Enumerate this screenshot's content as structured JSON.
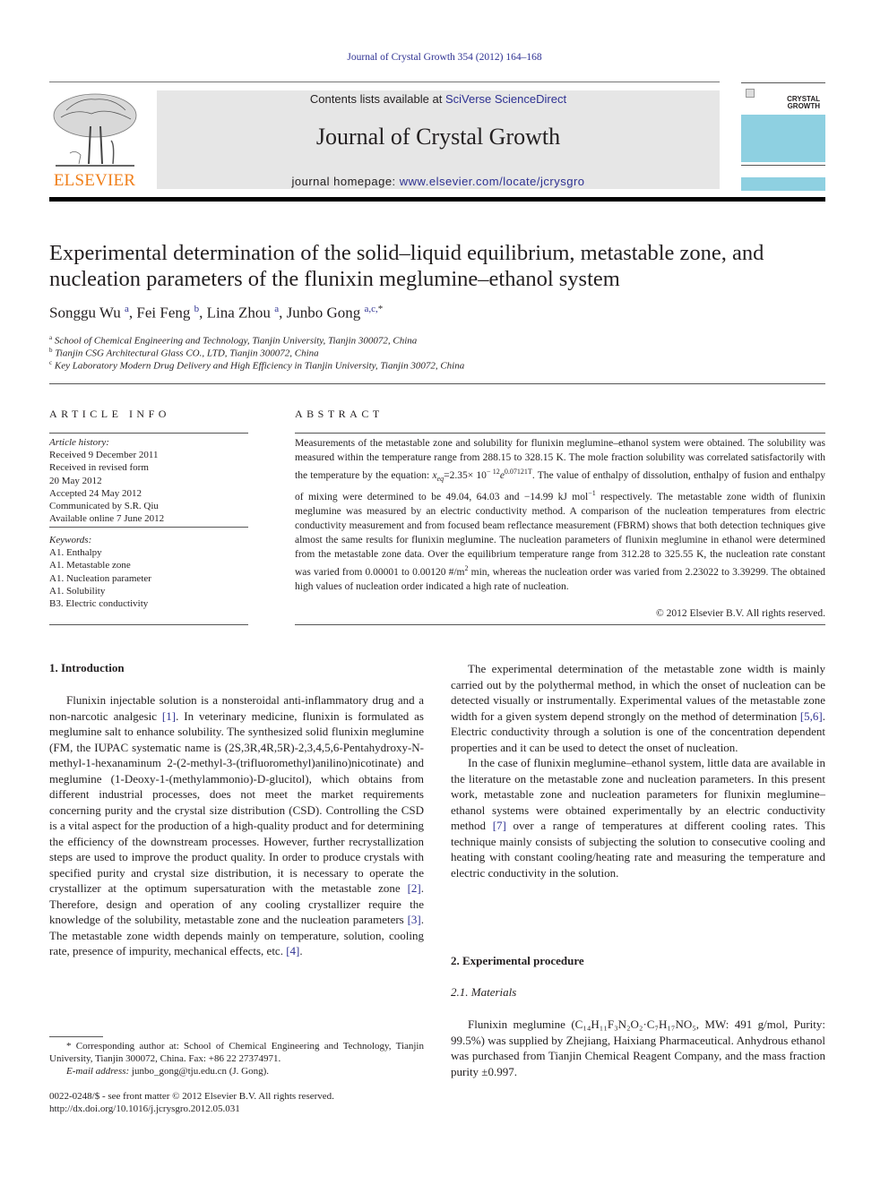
{
  "header": {
    "journal_ref": "Journal of Crystal Growth 354 (2012) 164–168",
    "contents_prefix": "Contents lists available at ",
    "contents_link": "SciVerse ScienceDirect",
    "journal_title": "Journal of Crystal Growth",
    "homepage_prefix": "journal homepage: ",
    "homepage_link": "www.elsevier.com/locate/jcrysgro",
    "publisher_logo_text": "ELSEVIER",
    "cover_title_line1": "CRYSTAL",
    "cover_title_line2": "GROWTH",
    "colors": {
      "link": "#2e3192",
      "elsevier_orange": "#f07f1a",
      "band_gray": "#e6e6e6",
      "cover_blue": "#8ed0e1"
    }
  },
  "article": {
    "title": "Experimental determination of the solid–liquid equilibrium, metastable zone, and nucleation parameters of the flunixin meglumine–ethanol system",
    "authors": [
      {
        "name": "Songgu Wu",
        "sup": "a"
      },
      {
        "name": "Fei Feng",
        "sup": "b"
      },
      {
        "name": "Lina Zhou",
        "sup": "a"
      },
      {
        "name": "Junbo Gong",
        "sup": "a,c,",
        "star": "*"
      }
    ],
    "affiliations": [
      {
        "mark": "a",
        "text": "School of Chemical Engineering and Technology, Tianjin University, Tianjin 300072, China"
      },
      {
        "mark": "b",
        "text": "Tianjin CSG Architectural Glass CO., LTD, Tianjin 300072, China"
      },
      {
        "mark": "c",
        "text": "Key Laboratory Modern Drug Delivery and High Efficiency in Tianjin University, Tianjin 30072, China"
      }
    ]
  },
  "article_info": {
    "heading": "ARTICLE INFO",
    "history_label": "Article history:",
    "history": [
      "Received 9 December 2011",
      "Received in revised form",
      "20 May 2012",
      "Accepted 24 May 2012",
      "Communicated by S.R. Qiu",
      "Available online 7 June 2012"
    ],
    "keywords_label": "Keywords:",
    "keywords": [
      "A1. Enthalpy",
      "A1. Metastable zone",
      "A1. Nucleation parameter",
      "A1. Solubility",
      "B3. Electric conductivity"
    ]
  },
  "abstract": {
    "heading": "ABSTRACT",
    "part1": "Measurements of the metastable zone and solubility for flunixin meglumine–ethanol system were obtained. The solubility was measured within the temperature range from 288.15 to 328.15 K. The mole fraction solubility was correlated satisfactorily with the temperature by the equation: ",
    "eq_x": "x",
    "eq_sub": "eq",
    "eq_mid": "=2.35× 10",
    "eq_exp1": "− 12",
    "eq_e": "e",
    "eq_exp2": "0.07121T",
    "part2": ". The value of enthalpy of dissolution, enthalpy of fusion and enthalpy of mixing were determined to be 49.04, 64.03 and −14.99 kJ mol",
    "unit_exp": "−1",
    "part3": " respectively. The metastable zone width of flunixin meglumine was measured by an electric conductivity method. A comparison of the nucleation temperatures from electric conductivity measurement and from focused beam reflectance measurement (FBRM) shows that both detection techniques give almost the same results for flunixin meglumine. The nucleation parameters of flunixin meglumine in ethanol were determined from the metastable zone data. Over the equilibrium temperature range from 312.28 to 325.55 K, the nucleation rate constant was varied from 0.00001 to 0.00120 #/m",
    "area_exp": "2",
    "part4": " min, whereas the nucleation order was varied from 2.23022 to 3.39299. The obtained high values of nucleation order indicated a high rate of nucleation.",
    "copyright": "© 2012 Elsevier B.V. All rights reserved."
  },
  "body": {
    "intro_heading": "1.  Introduction",
    "intro_p1_a": "Flunixin injectable solution is a nonsteroidal anti-inflammatory drug and a non-narcotic analgesic ",
    "ref1": "[1]",
    "intro_p1_b": ". In veterinary medicine, flunixin is formulated as meglumine salt to enhance solubility. The synthesized solid flunixin meglumine (FM, the IUPAC systematic name is (2S,3R,4R,5R)-2,3,4,5,6-Pentahydroxy-N-methyl-1-hexanaminum 2-(2-methyl-3-(trifluoromethyl)anilino)nicotinate) and meglumine (1-Deoxy-1-(methylammonio)-D-glucitol), which obtains from different industrial processes, does not meet the market requirements concerning purity and the crystal size distribution (CSD). Controlling the CSD is a vital aspect for the production of a high-quality product and for determining the efficiency of the downstream processes. However, further recrystallization steps are used to improve the product quality. In order to produce crystals with specified purity and crystal size distribution, it is necessary to operate the crystallizer at the optimum supersaturation with the metastable zone ",
    "ref2": "[2]",
    "intro_p1_c": ". Therefore, design and operation of any cooling crystallizer require the knowledge of the solubility, metastable zone and the nucleation parameters ",
    "ref3": "[3]",
    "intro_p1_d": ". The metastable zone width depends mainly on temperature, solution, cooling rate, presence of impurity, mechanical effects, etc. ",
    "ref4": "[4]",
    "intro_p1_e": ".",
    "right_p1_a": "The experimental determination of the metastable zone width is mainly carried out by the polythermal method, in which the onset of nucleation can be detected visually or instrumentally. Experimental values of the metastable zone width for a given system depend strongly on the method of determination ",
    "ref56": "[5,6]",
    "right_p1_b": ". Electric conductivity through a solution is one of the concentration dependent properties and it can be used to detect the onset of nucleation.",
    "right_p2_a": "In the case of flunixin meglumine–ethanol system, little data are available in the literature on the metastable zone and nucleation parameters. In this present work, metastable zone and nucleation parameters for flunixin meglumine–ethanol systems were obtained experimentally by an electric conductivity method ",
    "ref7": "[7]",
    "right_p2_b": " over a range of temperatures at different cooling rates. This technique mainly consists of subjecting the solution to consecutive cooling and heating with constant cooling/heating rate and measuring the temperature and electric conductivity in the solution.",
    "exp_heading": "2.  Experimental procedure",
    "materials_heading": "2.1.  Materials",
    "materials_text": "Flunixin meglumine (C₁₄H₁₁F₃N₂O₂·C₇H₁₇NO₅, MW: 491 g/mol, Purity: 99.5%) was supplied by Zhejiang, Haixiang Pharmaceutical. Anhydrous ethanol was purchased from Tianjin Chemical Reagent Company, and the mass fraction purity ±0.997."
  },
  "footnote": {
    "star_text": "* Corresponding author at: School of Chemical Engineering and Technology, Tianjin University, Tianjin 300072, China. Fax: +86 22 27374971.",
    "email_label": "E-mail address:",
    "email": " junbo_gong@tju.edu.cn (J. Gong).",
    "front_matter": "0022-0248/$ - see front matter © 2012 Elsevier B.V. All rights reserved.",
    "doi": "http://dx.doi.org/10.1016/j.jcrysgro.2012.05.031"
  }
}
